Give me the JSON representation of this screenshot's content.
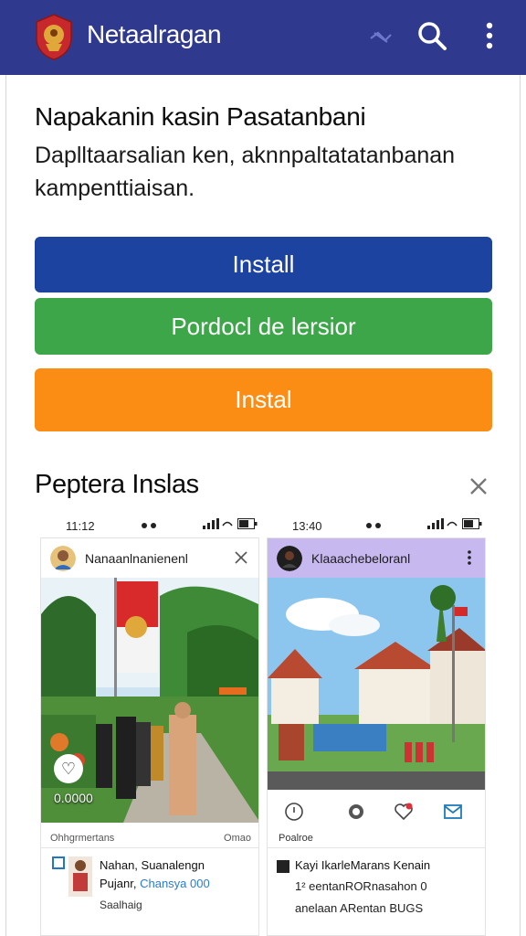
{
  "app": {
    "title": "Netaalragan",
    "bar_color": "#2f3a8f"
  },
  "intro": {
    "headline": "Napakanin kasin Pasatanbani",
    "description": "Daplltaarsalian ken, aknnpaltatatanbanan kampenttiaisan."
  },
  "buttons": {
    "primary": "Install",
    "secondary": "Pordocl de lersior",
    "tertiary": "Instal"
  },
  "section": {
    "title": "Peptera Inslas"
  },
  "screens": [
    {
      "status_time": "11:12",
      "status_icons": "✉ ●",
      "account_name": "Nanaanlnanienenl",
      "photo_count": "0.0000",
      "stats_left": "Ohhgrmertans",
      "stats_right": "Omao",
      "item_line1": "Nahan, Suanalengn",
      "item_line2_prefix": "Pujanr, ",
      "item_line2_tag": "Chansya 000",
      "item_line3": "Saalhaig"
    },
    {
      "status_time": "13:40",
      "status_icons": "✉ ●",
      "account_name": "Klaaachebeloranl",
      "posted_label": "Poalroe",
      "item_line1": "Kayi IkarleMarans Kenain",
      "item_line2": "1² eentanRORnasahon 0",
      "item_line3": "anelaan ARentan BUGS"
    }
  ],
  "colors": {
    "install": "#1d43a1",
    "green": "#3ca648",
    "orange": "#fb8c14",
    "right_card_header": "#c7b8f0"
  }
}
